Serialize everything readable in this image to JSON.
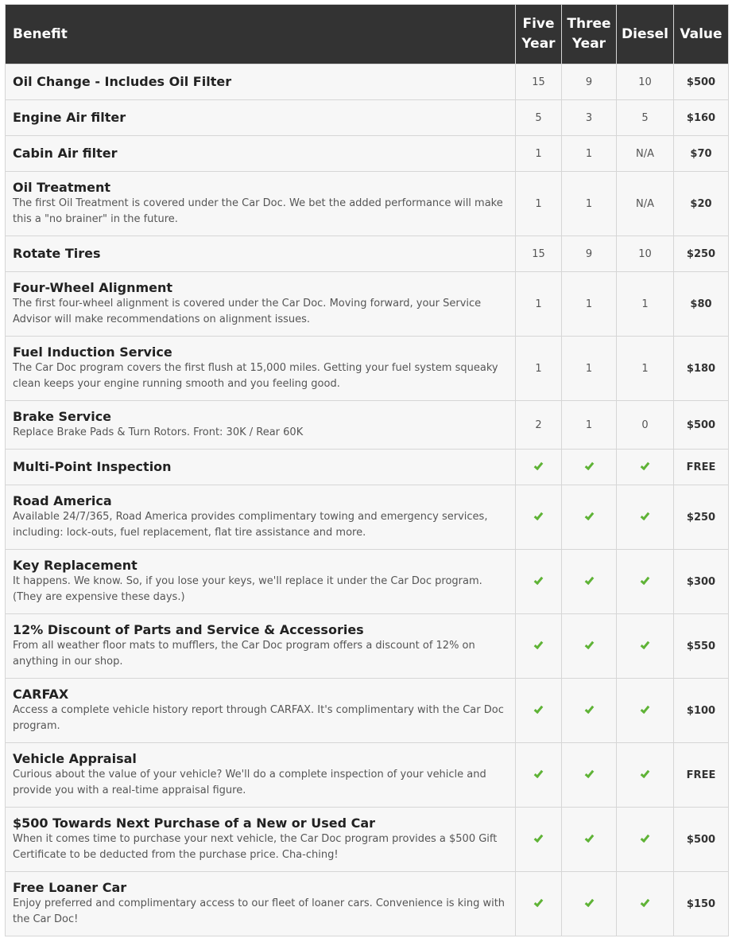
{
  "colors": {
    "header_bg": "#333333",
    "check_green": "#5fb336",
    "row_bg": "#f7f7f7"
  },
  "headers": {
    "benefit": "Benefit",
    "five_year": "Five Year",
    "three_year": "Three Year",
    "diesel": "Diesel",
    "value": "Value"
  },
  "rows": [
    {
      "title": "Oil Change - Includes Oil Filter",
      "desc": "",
      "five": "15",
      "three": "9",
      "diesel": "10",
      "value": "$500"
    },
    {
      "title": "Engine Air filter",
      "desc": "",
      "five": "5",
      "three": "3",
      "diesel": "5",
      "value": "$160"
    },
    {
      "title": "Cabin Air filter",
      "desc": "",
      "five": "1",
      "three": "1",
      "diesel": "N/A",
      "value": "$70"
    },
    {
      "title": "Oil Treatment",
      "desc": "The first Oil Treatment is covered under the Car Doc. We bet the added performance will make this a \"no brainer\" in the future.",
      "five": "1",
      "three": "1",
      "diesel": "N/A",
      "value": "$20"
    },
    {
      "title": "Rotate Tires",
      "desc": "",
      "five": "15",
      "three": "9",
      "diesel": "10",
      "value": "$250"
    },
    {
      "title": "Four-Wheel Alignment",
      "desc": "The first four-wheel alignment is covered under the Car Doc. Moving forward, your Service Advisor will make recommendations on alignment issues.",
      "five": "1",
      "three": "1",
      "diesel": "1",
      "value": "$80"
    },
    {
      "title": "Fuel Induction Service",
      "desc": "The Car Doc program covers the first flush at 15,000 miles. Getting your fuel system squeaky clean keeps your engine running smooth and you feeling good.",
      "five": "1",
      "three": "1",
      "diesel": "1",
      "value": "$180"
    },
    {
      "title": "Brake Service",
      "desc": "Replace Brake Pads & Turn Rotors. Front: 30K / Rear 60K",
      "five": "2",
      "three": "1",
      "diesel": "0",
      "value": "$500"
    },
    {
      "title": "Multi-Point Inspection",
      "desc": "",
      "five": "check",
      "three": "check",
      "diesel": "check",
      "value": "FREE"
    },
    {
      "title": "Road America",
      "desc": "Available 24/7/365, Road America provides complimentary towing and emergency services, including: lock-outs, fuel replacement, flat tire assistance and more.",
      "five": "check",
      "three": "check",
      "diesel": "check",
      "value": "$250"
    },
    {
      "title": "Key Replacement",
      "desc": "It happens. We know. So, if you lose your keys, we'll replace it under the Car Doc program. (They are expensive these days.)",
      "five": "check",
      "three": "check",
      "diesel": "check",
      "value": "$300"
    },
    {
      "title": "12% Discount of Parts and Service & Accessories",
      "desc": "From all weather floor mats to mufflers, the Car Doc program offers a discount of 12% on anything in our shop.",
      "five": "check",
      "three": "check",
      "diesel": "check",
      "value": "$550"
    },
    {
      "title": "CARFAX",
      "desc": "Access a complete vehicle history report through CARFAX. It's complimentary with the Car Doc program.",
      "five": "check",
      "three": "check",
      "diesel": "check",
      "value": "$100"
    },
    {
      "title": "Vehicle Appraisal",
      "desc": "Curious about the value of your vehicle? We'll do a complete inspection of your vehicle and provide you with a real-time appraisal figure.",
      "five": "check",
      "three": "check",
      "diesel": "check",
      "value": "FREE"
    },
    {
      "title": "$500 Towards Next Purchase of a New or Used Car",
      "desc": "When it comes time to purchase your next vehicle, the Car Doc program provides a $500 Gift Certificate to be deducted from the purchase price. Cha-ching!",
      "five": "check",
      "three": "check",
      "diesel": "check",
      "value": "$500"
    },
    {
      "title": "Free Loaner Car",
      "desc": "Enjoy preferred and complimentary access to our fleet of loaner cars. Convenience is king with the Car Doc!",
      "five": "check",
      "three": "check",
      "diesel": "check",
      "value": "$150"
    }
  ]
}
